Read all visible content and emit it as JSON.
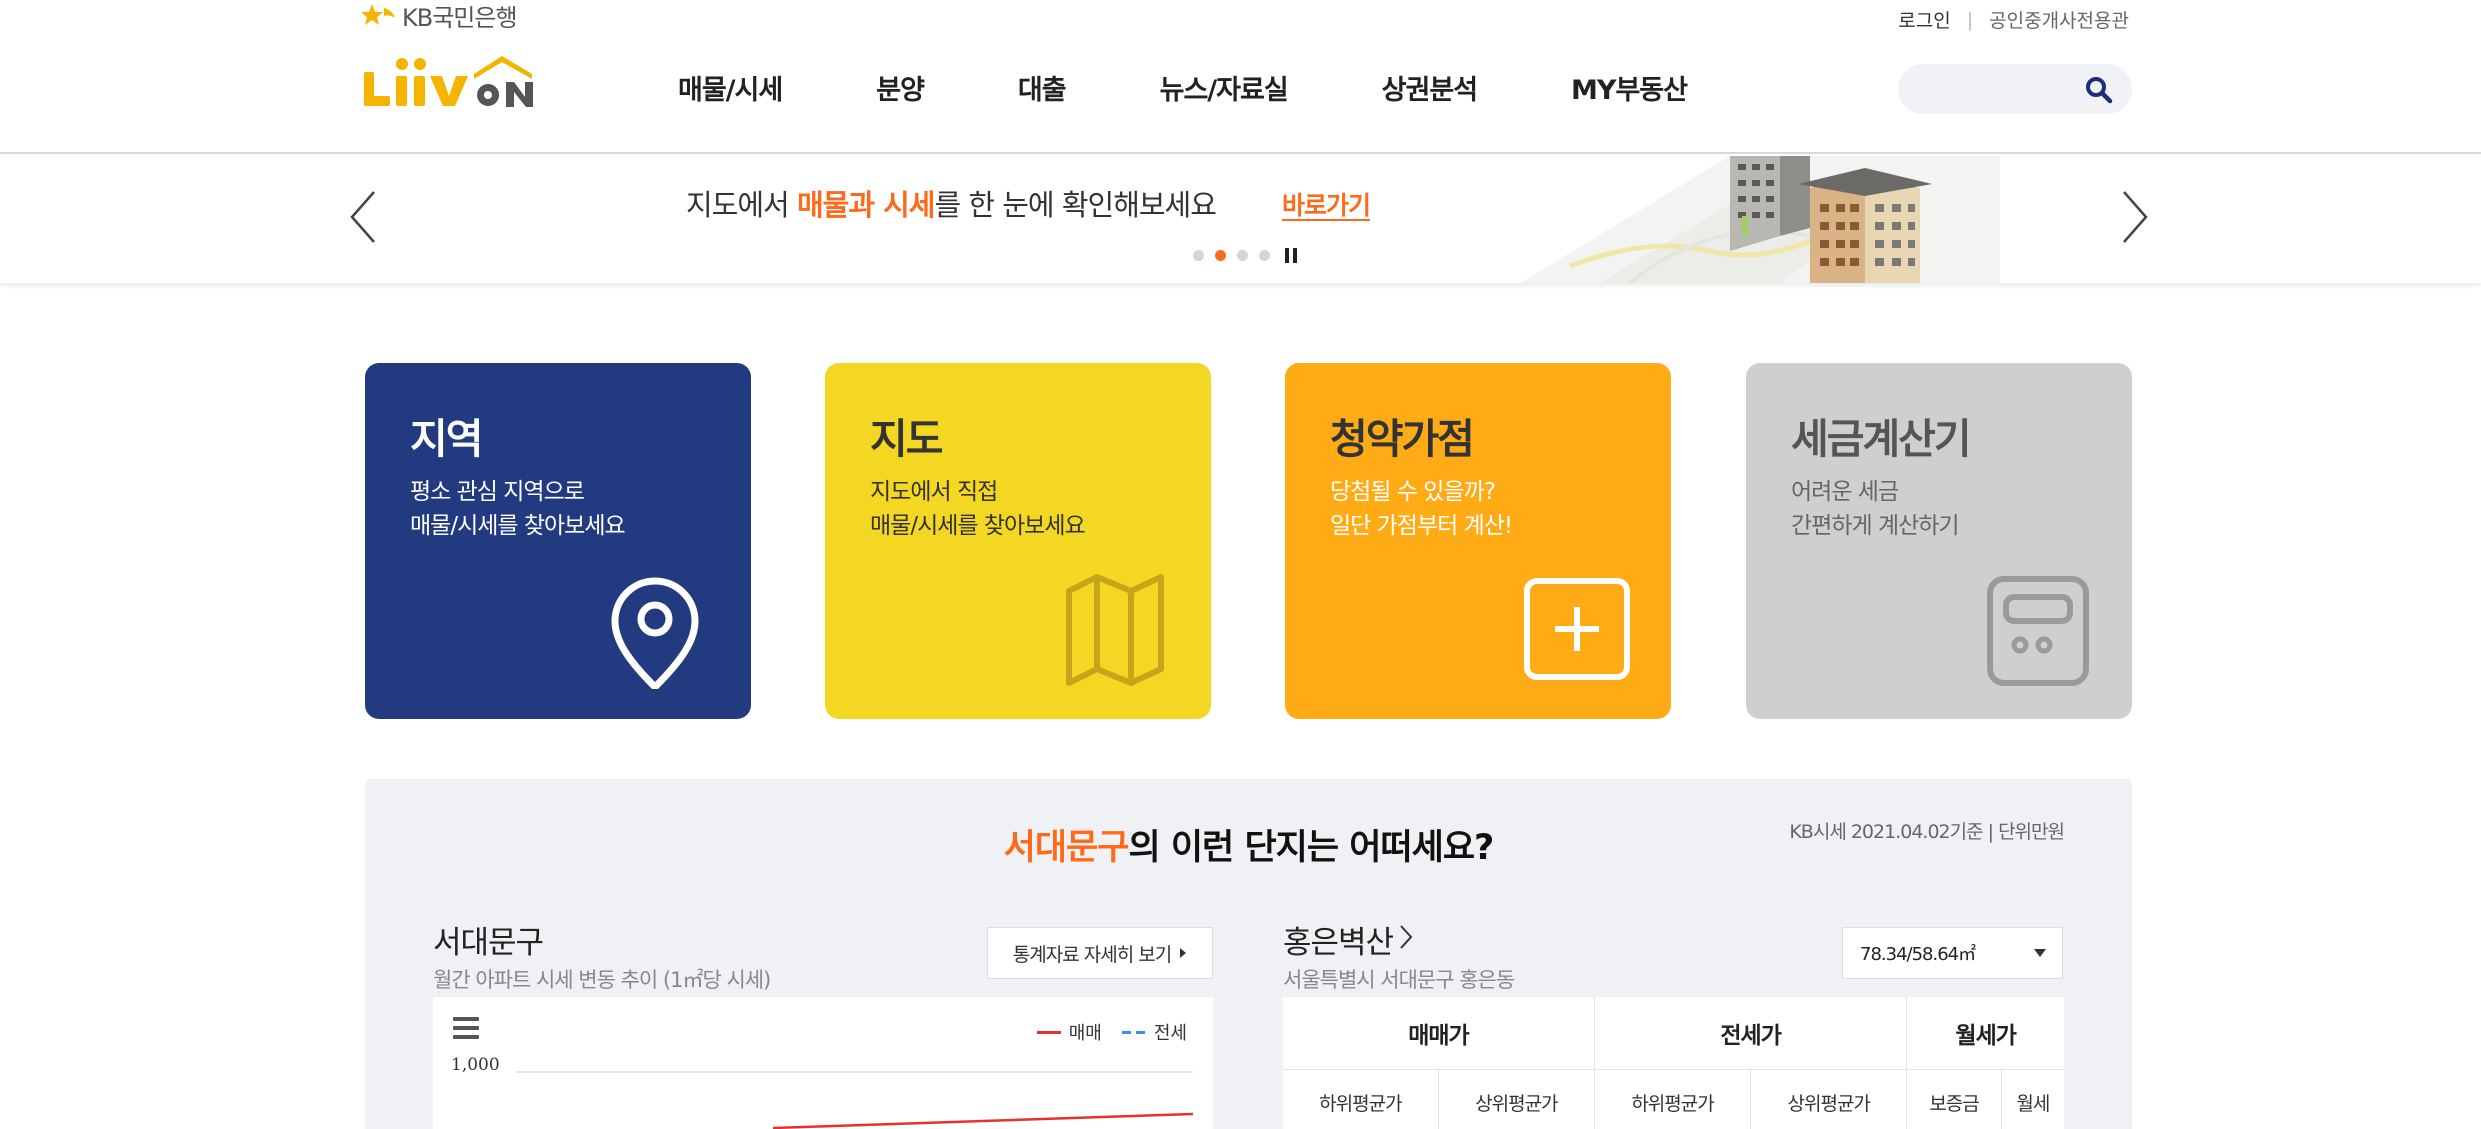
{
  "brand": {
    "bank_name": "KB국민은행",
    "logo_text": "Liiv ON"
  },
  "top_links": {
    "login": "로그인",
    "agent": "공인중개사전용관"
  },
  "nav": {
    "items": [
      "매물/시세",
      "분양",
      "대출",
      "뉴스/자료실",
      "상권분석",
      "MY부동산"
    ]
  },
  "search": {
    "placeholder": "",
    "icon": "search-icon"
  },
  "banner": {
    "text_before": "지도에서 ",
    "text_highlight": "매물과 시세",
    "text_after": "를 한 눈에 확인해보세요",
    "link_label": "바로가기",
    "slide_count": 4,
    "active_slide": 2
  },
  "cards": [
    {
      "title": "지역",
      "line1": "평소 관심 지역으로",
      "line2": "매물/시세를 찾아보세요",
      "icon": "location-pin-icon"
    },
    {
      "title": "지도",
      "line1": "지도에서 직접",
      "line2": "매물/시세를 찾아보세요",
      "icon": "map-icon"
    },
    {
      "title": "청약가점",
      "line1": "당첨될 수 있을까?",
      "line2": "일단 가점부터 계산!",
      "icon": "plus-square-icon"
    },
    {
      "title": "세금계산기",
      "line1": "어려운 세금",
      "line2": "간편하게 계산하기",
      "icon": "calculator-icon"
    }
  ],
  "complex_section": {
    "title_highlight": "서대문구",
    "title_rest": "의 이런 단지는 어떠세요?",
    "note": "KB시세 2021.04.02기준 | 단위만원",
    "region": {
      "name": "서대문구",
      "subtitle": "월간 아파트 시세 변동 추이 (1㎡당 시세)",
      "stat_button": "통계자료 자세히 보기"
    },
    "complex": {
      "name": "홍은벽산",
      "address": "서울특별시 서대문구 홍은동",
      "size_selected": "78.34/58.64㎡"
    },
    "table": {
      "headers": [
        "매매가",
        "전세가",
        "월세가"
      ],
      "subheaders": [
        "하위평균가",
        "상위평균가",
        "하위평균가",
        "상위평균가",
        "보증금",
        "월세"
      ]
    }
  },
  "chart_data": {
    "type": "line",
    "series": [
      {
        "name": "매매",
        "color": "#e8312f"
      },
      {
        "name": "전세",
        "color": "#3c8ee6"
      }
    ],
    "y_tick_labels": [
      "1,000"
    ],
    "grid": true,
    "legend": "top-right"
  },
  "colors": {
    "accent": "#ff6a1a",
    "navy": "#223b80",
    "yellow": "#f4d723",
    "orange": "#ffab16",
    "gray": "#cfcfcf"
  }
}
